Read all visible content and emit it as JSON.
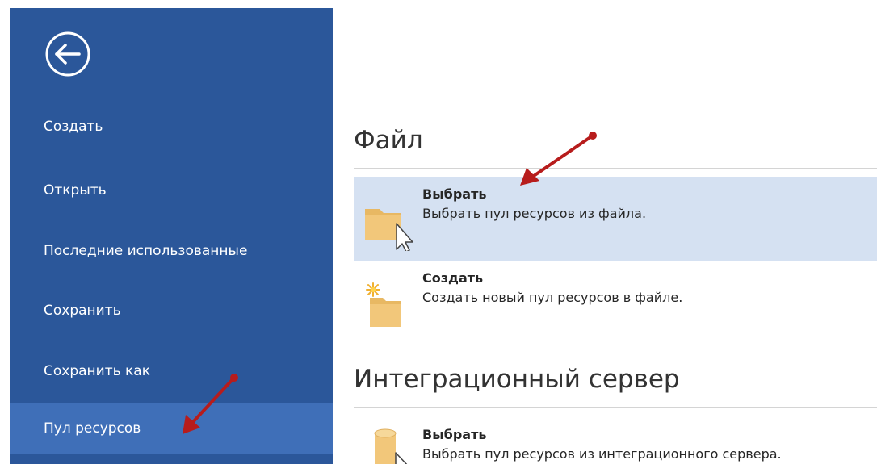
{
  "sidebar": {
    "items": [
      {
        "label": "Создать"
      },
      {
        "label": "Открыть"
      },
      {
        "label": "Последние использованные"
      },
      {
        "label": "Сохранить"
      },
      {
        "label": "Сохранить как"
      },
      {
        "label": "Пул ресурсов"
      }
    ],
    "active_index": 5
  },
  "main": {
    "sections": [
      {
        "title": "Файл",
        "options": [
          {
            "title": "Выбрать",
            "desc": "Выбрать пул ресурсов из файла.",
            "icon": "folder-icon"
          },
          {
            "title": "Создать",
            "desc": "Создать новый пул ресурсов в файле.",
            "icon": "new-folder-icon"
          }
        ]
      },
      {
        "title": "Интеграционный сервер",
        "options": [
          {
            "title": "Выбрать",
            "desc": "Выбрать пул ресурсов из интеграционного сервера.",
            "icon": "database-icon"
          }
        ]
      }
    ]
  },
  "colors": {
    "sidebar_bg": "#2b579a",
    "sidebar_active": "#3f6fb8",
    "hover_bg": "#d5e1f2",
    "annotation_arrow": "#b71c1c"
  }
}
